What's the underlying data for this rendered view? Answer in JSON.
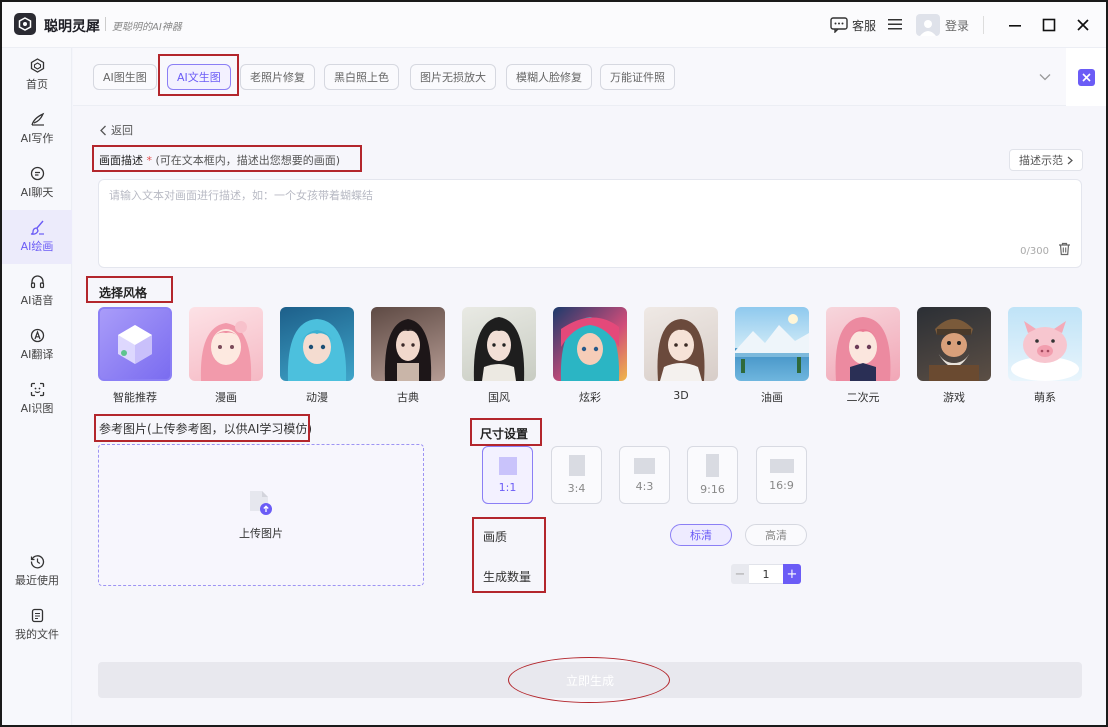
{
  "app": {
    "name": "聪明灵犀",
    "slogan": "更聪明的AI神器"
  },
  "titlebar": {
    "service_label": "客服",
    "login_label": "登录"
  },
  "sidebar": {
    "items": [
      {
        "label": "首页",
        "icon": "home-icon"
      },
      {
        "label": "AI写作",
        "icon": "pen-icon"
      },
      {
        "label": "AI聊天",
        "icon": "chat-icon"
      },
      {
        "label": "AI绘画",
        "icon": "brush-icon",
        "active": true
      },
      {
        "label": "AI语音",
        "icon": "headphone-icon"
      },
      {
        "label": "AI翻译",
        "icon": "translate-icon"
      },
      {
        "label": "AI识图",
        "icon": "scan-icon"
      }
    ],
    "bottom": [
      {
        "label": "最近使用",
        "icon": "history-icon"
      },
      {
        "label": "我的文件",
        "icon": "file-icon"
      }
    ]
  },
  "tabs": [
    {
      "label": "AI图生图"
    },
    {
      "label": "AI文生图",
      "active": true
    },
    {
      "label": "老照片修复"
    },
    {
      "label": "黑白照上色"
    },
    {
      "label": "图片无损放大"
    },
    {
      "label": "模糊人脸修复"
    },
    {
      "label": "万能证件照"
    }
  ],
  "back_label": "返回",
  "description": {
    "label": "画面描述",
    "required_mark": "*",
    "hint": "(可在文本框内，描述出您想要的画面)",
    "example_button": "描述示范",
    "placeholder": "请输入文本对画面进行描述，如：一个女孩带着蝴蝶结",
    "value": "",
    "counter": "0/300"
  },
  "style_section": {
    "title": "选择风格",
    "styles": [
      {
        "label": "智能推荐",
        "active": true
      },
      {
        "label": "漫画"
      },
      {
        "label": "动漫"
      },
      {
        "label": "古典"
      },
      {
        "label": "国风"
      },
      {
        "label": "炫彩"
      },
      {
        "label": "3D"
      },
      {
        "label": "油画"
      },
      {
        "label": "二次元"
      },
      {
        "label": "游戏"
      },
      {
        "label": "萌系"
      }
    ]
  },
  "reference": {
    "label": "参考图片(上传参考图，以供AI学习模仿)",
    "upload_label": "上传图片"
  },
  "size_settings": {
    "title": "尺寸设置",
    "ratios": [
      {
        "label": "1:1",
        "active": true
      },
      {
        "label": "3:4"
      },
      {
        "label": "4:3"
      },
      {
        "label": "9:16"
      },
      {
        "label": "16:9"
      }
    ]
  },
  "quality": {
    "label": "画质",
    "options": [
      {
        "label": "标清",
        "active": true
      },
      {
        "label": "高清"
      }
    ]
  },
  "count": {
    "label": "生成数量",
    "value": "1",
    "minus": "−",
    "plus": "+"
  },
  "generate_button": "立即生成",
  "colors": {
    "accent": "#6b5cf6",
    "annotation": "#b3262c"
  }
}
